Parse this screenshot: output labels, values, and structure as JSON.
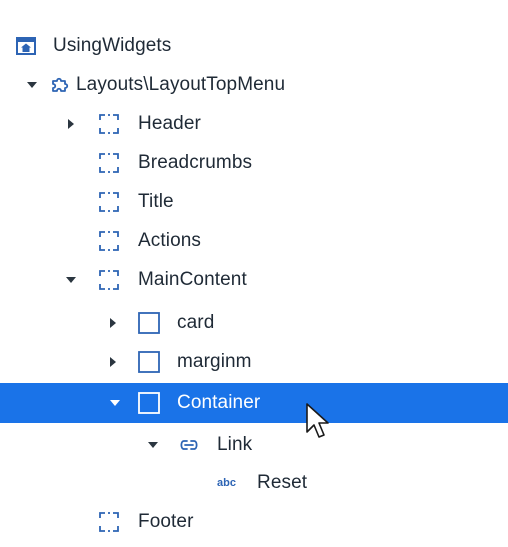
{
  "tree": {
    "root": {
      "label": "UsingWidgets",
      "icon": "home-screen-icon"
    },
    "layout": {
      "label": "Layouts\\LayoutTopMenu",
      "icon": "puzzle-icon",
      "expanded": true
    },
    "placeholders": [
      {
        "label": "Header",
        "icon": "placeholder-icon",
        "has_children": true,
        "expanded": false
      },
      {
        "label": "Breadcrumbs",
        "icon": "placeholder-icon"
      },
      {
        "label": "Title",
        "icon": "placeholder-icon"
      },
      {
        "label": "Actions",
        "icon": "placeholder-icon"
      },
      {
        "label": "MainContent",
        "icon": "placeholder-icon",
        "has_children": true,
        "expanded": true
      }
    ],
    "main_children": [
      {
        "label": "card",
        "icon": "container-icon",
        "expanded": false
      },
      {
        "label": "marginm",
        "icon": "container-icon",
        "expanded": false
      },
      {
        "label": "Container",
        "icon": "container-icon",
        "expanded": true,
        "selected": true
      }
    ],
    "link": {
      "label": "Link",
      "icon": "link-icon",
      "expanded": true
    },
    "text": {
      "label": "Reset",
      "icon_text": "abc"
    },
    "footer": {
      "label": "Footer",
      "icon": "placeholder-icon"
    }
  },
  "colors": {
    "accent": "#1a73e8",
    "icon_blue": "#2d64b4",
    "text": "#1f2a36"
  }
}
